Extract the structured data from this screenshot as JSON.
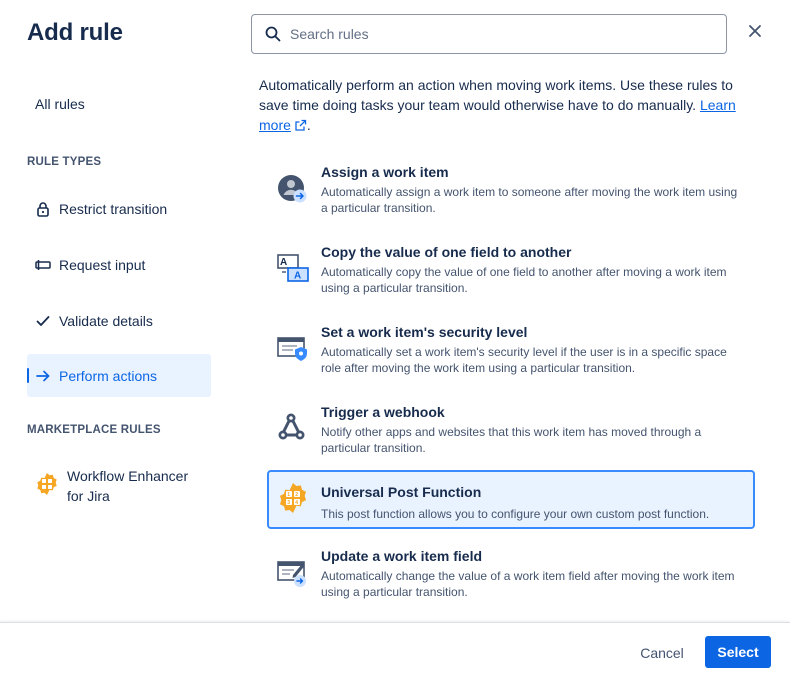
{
  "dialog": {
    "title": "Add rule"
  },
  "sidebar": {
    "all_rules": "All rules",
    "rule_types_heading": "RULE TYPES",
    "items": [
      {
        "label": "Restrict transition",
        "icon": "lock-icon"
      },
      {
        "label": "Request input",
        "icon": "input-field-icon"
      },
      {
        "label": "Validate details",
        "icon": "check-icon"
      },
      {
        "label": "Perform actions",
        "icon": "arrow-right-icon",
        "active": true
      }
    ],
    "marketplace_heading": "MARKETPLACE RULES",
    "marketplace_items": [
      {
        "label": "Workflow Enhancer for Jira",
        "icon": "workflow-enhancer-icon"
      }
    ]
  },
  "search": {
    "placeholder": "Search rules",
    "value": ""
  },
  "intro": {
    "text": "Automatically perform an action when moving work items. Use these rules to save time doing tasks your team would otherwise have to do manually.",
    "link": "Learn more",
    "suffix": "."
  },
  "rules": [
    {
      "title": "Assign a work item",
      "description": "Automatically assign a work item to someone after moving the work item using a particular transition.",
      "icon": "assign-user-icon"
    },
    {
      "title": "Copy the value of one field to another",
      "description": "Automatically copy the value of one field to another after moving a work item using a particular transition.",
      "icon": "copy-field-icon"
    },
    {
      "title": "Set a work item's security level",
      "description": "Automatically set a work item's security level if the user is in a specific space role after moving the work item using a particular transition.",
      "icon": "security-level-icon"
    },
    {
      "title": "Trigger a webhook",
      "description": "Notify other apps and websites that this work item has moved through a particular transition.",
      "icon": "webhook-icon"
    },
    {
      "title": "Universal Post Function",
      "description": "This post function allows you to configure your own custom post function.",
      "icon": "universal-post-function-icon",
      "selected": true
    },
    {
      "title": "Update a work item field",
      "description": "Automatically change the value of a work item field after moving the work item using a particular transition.",
      "icon": "update-field-icon"
    }
  ],
  "footer": {
    "cancel_label": "Cancel",
    "select_label": "Select"
  },
  "colors": {
    "accent": "#0c66e4",
    "selected_bg": "#e9f2ff",
    "selected_border": "#388bff",
    "text": "#172b4d",
    "subtle_text": "#44546f"
  }
}
